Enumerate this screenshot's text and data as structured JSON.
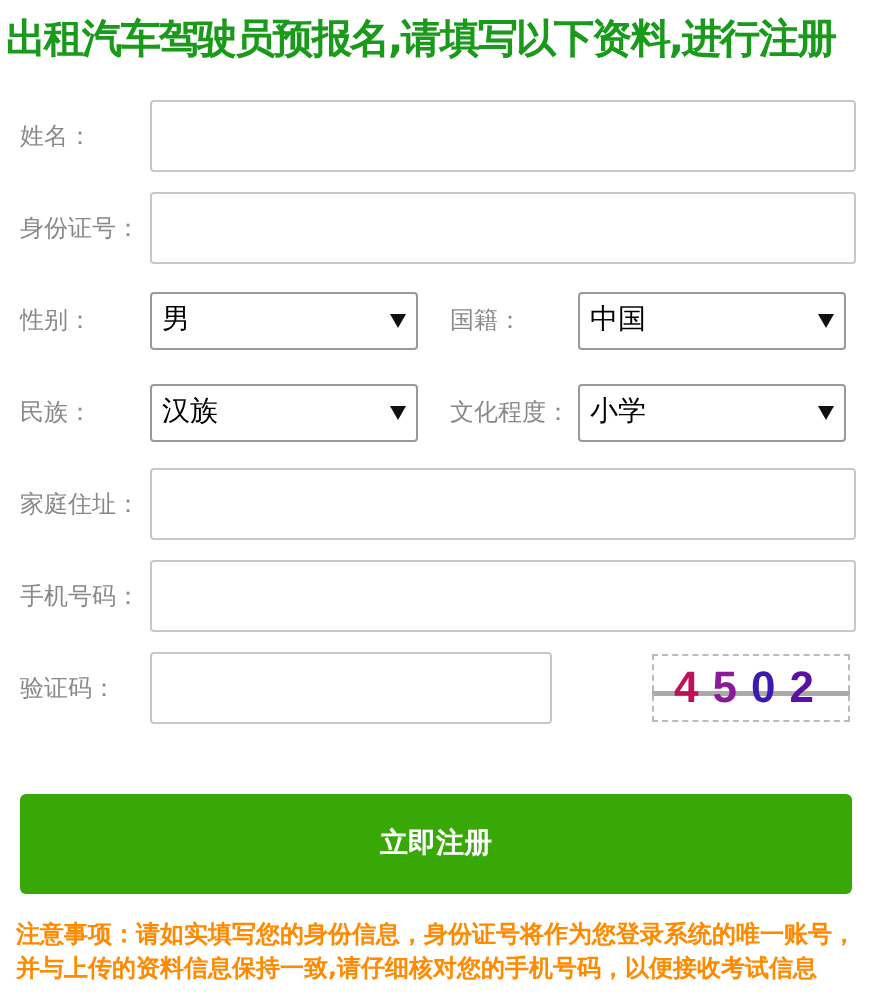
{
  "title": "出租汽车驾驶员预报名,请填写以下资料,进行注册",
  "rows": [
    {
      "fields": [
        {
          "kind": "text",
          "label": "姓名："
        }
      ]
    },
    {
      "fields": [
        {
          "kind": "text",
          "label": "身份证号："
        }
      ]
    },
    {
      "fields": [
        {
          "kind": "select",
          "label": "性别：",
          "value": "男"
        },
        {
          "kind": "select",
          "label": "国籍：",
          "value": "中国"
        }
      ]
    },
    {
      "fields": [
        {
          "kind": "select",
          "label": "民族：",
          "value": "汉族"
        },
        {
          "kind": "select",
          "label": "文化程度：",
          "value": "小学"
        }
      ]
    },
    {
      "fields": [
        {
          "kind": "text",
          "label": "家庭住址："
        }
      ]
    },
    {
      "fields": [
        {
          "kind": "text",
          "label": "手机号码："
        }
      ]
    },
    {
      "fields": [
        {
          "kind": "captcha",
          "label": "验证码：",
          "code": "4502"
        }
      ]
    }
  ],
  "submit": "立即注册",
  "notice": "注意事项：请如实填写您的身份信息，身份证号将作为您登录系统的唯一账号，并与上传的资料信息保持一致,请仔细核对您的手机号码，以便接收考试信息"
}
